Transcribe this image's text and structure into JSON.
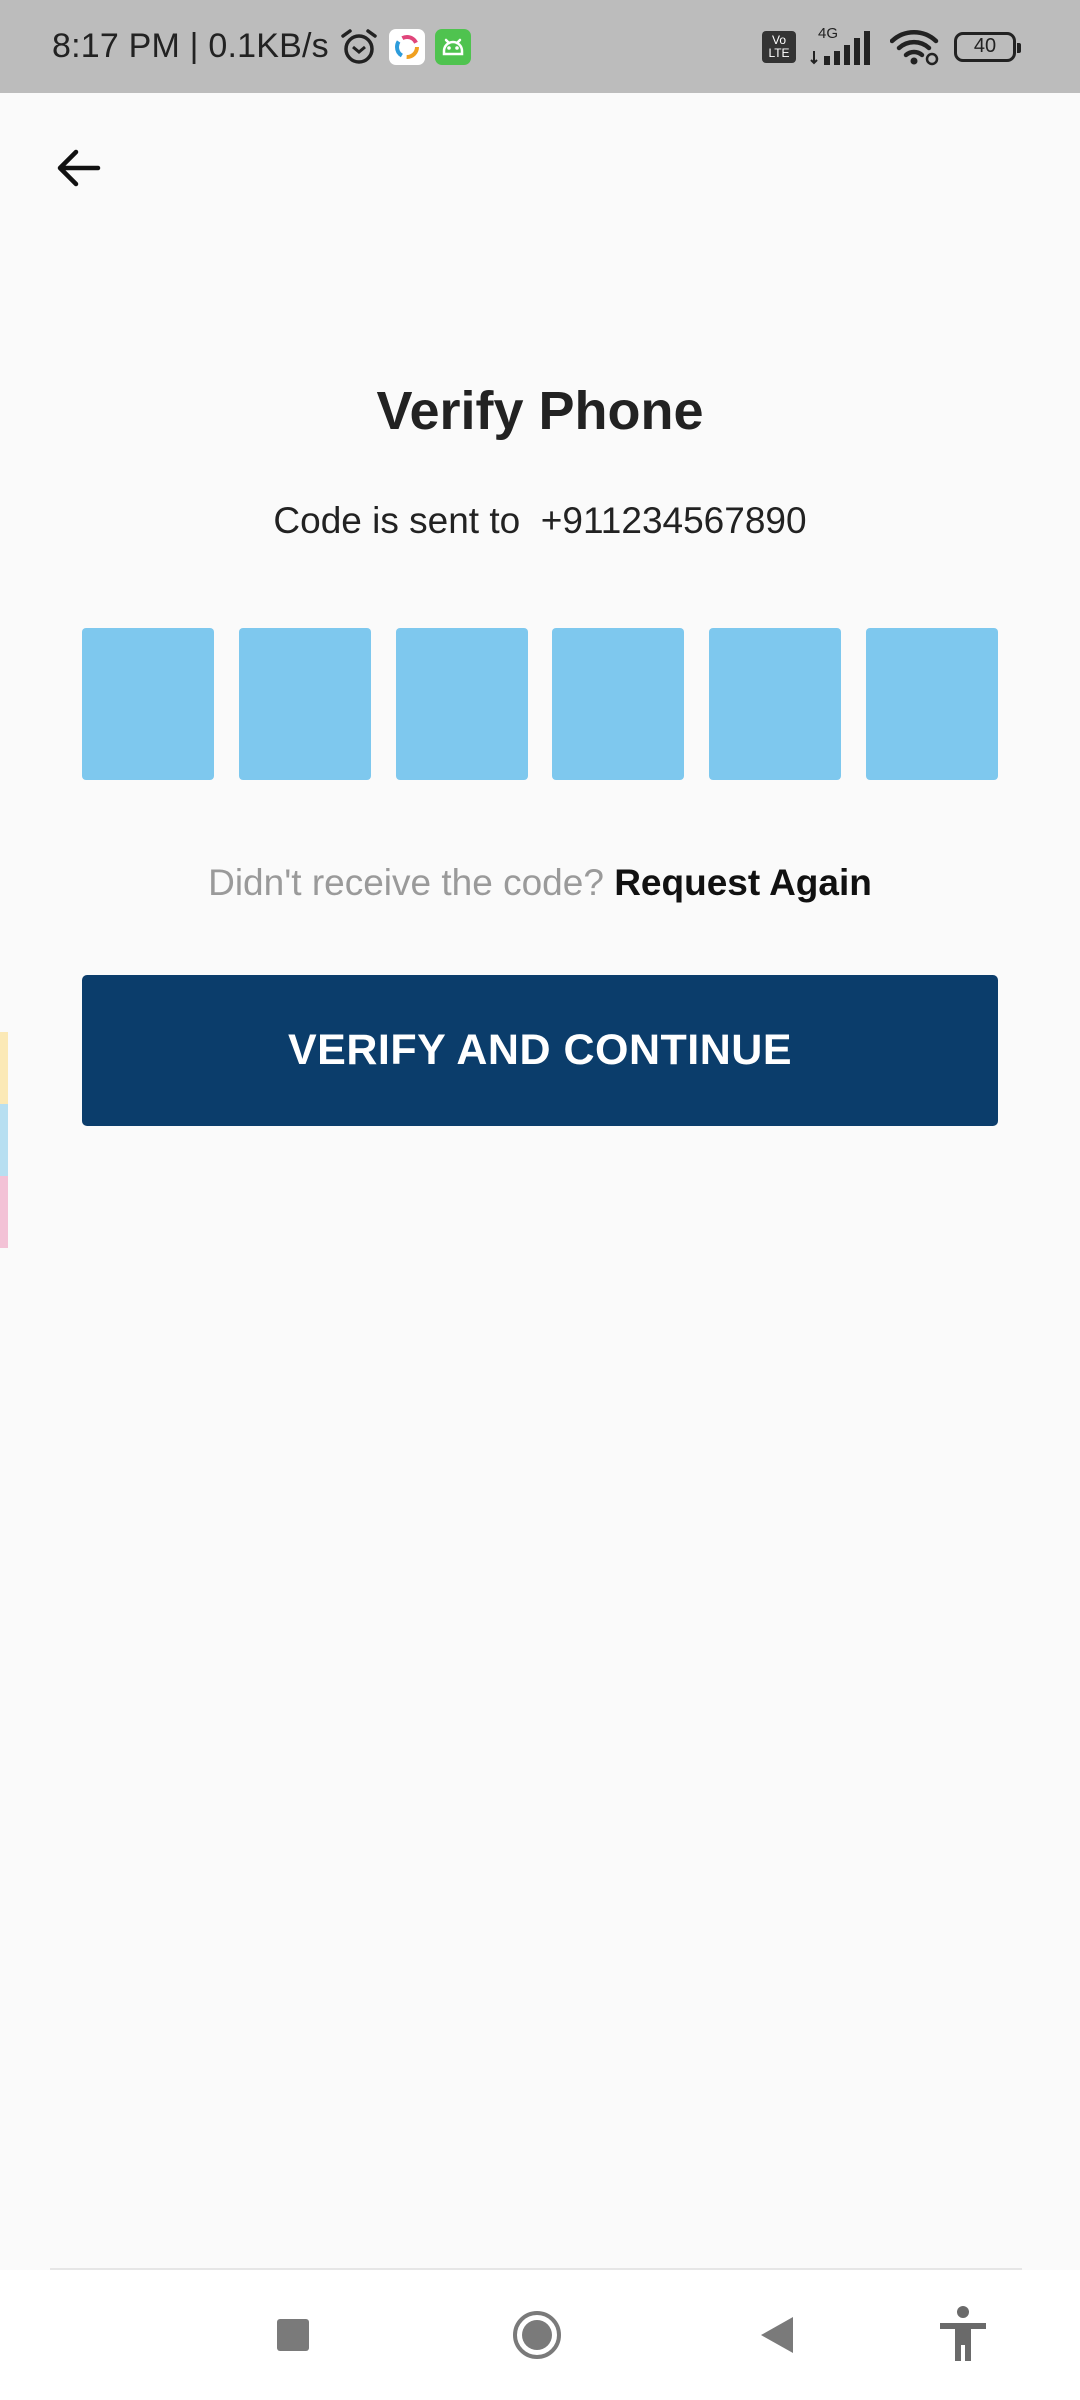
{
  "status_bar": {
    "time": "8:17 PM | 0.1KB/s",
    "network_type": "4G",
    "volte": "Vo LTE",
    "battery_level": "40",
    "icons": [
      "alarm-icon",
      "sync-app-icon",
      "android-robot-app-icon",
      "volte-icon",
      "cellular-signal-icon",
      "wifi-icon",
      "battery-icon"
    ]
  },
  "header": {
    "back_icon": "arrow-left-icon"
  },
  "main": {
    "title": "Verify Phone",
    "code_sent_text": "Code is sent to  +911234567890",
    "otp_boxes": [
      "",
      "",
      "",
      "",
      "",
      ""
    ],
    "resend_prompt": "Didn't receive the code? ",
    "resend_link": "Request Again",
    "verify_button_label": "VERIFY AND CONTINUE"
  },
  "edge_strip_colors": [
    "#fbe9b6",
    "#b7dff1",
    "#f3c2d6"
  ],
  "navigation_bar": {
    "buttons": [
      "recent-apps-icon",
      "home-icon",
      "back-triangle-icon",
      "accessibility-icon"
    ]
  },
  "colors": {
    "status_bar_bg": "#bcbcbc",
    "background": "#fafafa",
    "otp_box": "#7ec8ee",
    "primary_button": "#0b3d6b",
    "secondary_text": "#9a9a9a"
  }
}
